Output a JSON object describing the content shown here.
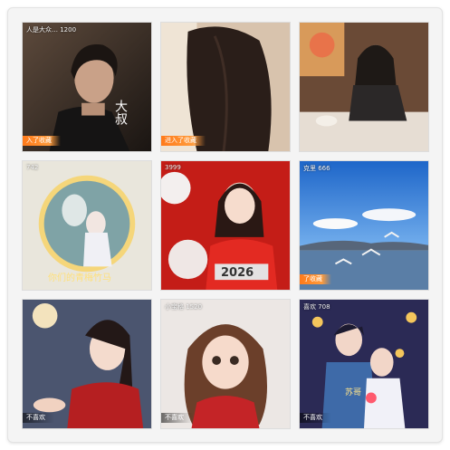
{
  "tiles": [
    {
      "meta": "人是大众…  1200",
      "badge": "入了收藏",
      "caption": "大叔"
    },
    {
      "meta": "",
      "badge": "进入了收藏",
      "caption": ""
    },
    {
      "meta": "",
      "badge": "",
      "caption": ""
    },
    {
      "meta": "742",
      "badge": "",
      "caption": "你们的青梅竹马"
    },
    {
      "meta": "3999",
      "badge": "",
      "caption": "2026"
    },
    {
      "meta": "克里  666",
      "badge": "了收藏",
      "caption": ""
    },
    {
      "meta": "",
      "badge": "不喜欢",
      "caption": ""
    },
    {
      "meta": "小宝格  1520",
      "badge": "不喜欢",
      "caption": ""
    },
    {
      "meta": "喜欢  708",
      "badge": "不喜欢",
      "caption": "苏哥"
    }
  ],
  "colors": {
    "accent": "#ff8a22",
    "frame_border": "#e3e3e3"
  }
}
